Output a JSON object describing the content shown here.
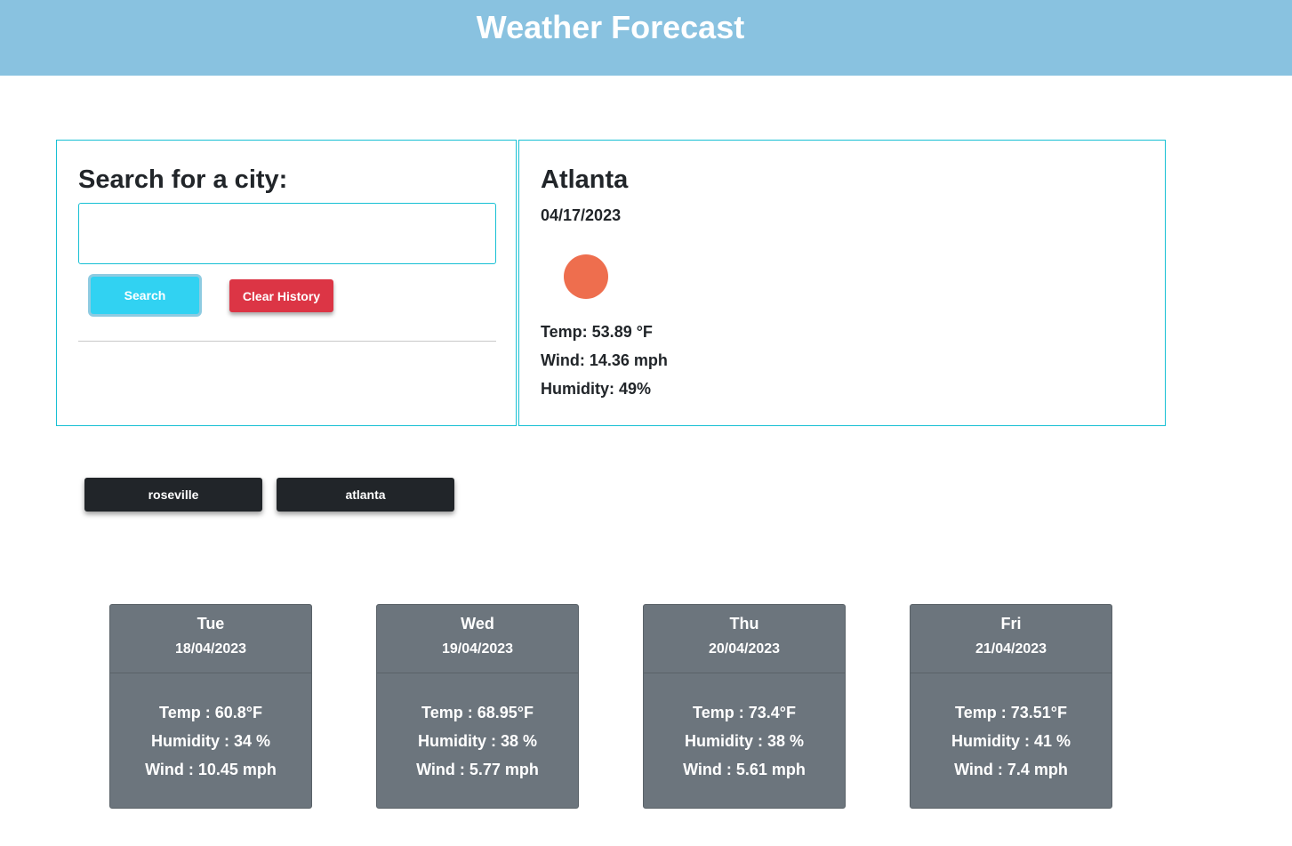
{
  "header": {
    "title": "Weather Forecast"
  },
  "search": {
    "heading": "Search for a city:",
    "input_value": "",
    "search_label": "Search",
    "clear_label": "Clear History"
  },
  "current": {
    "city": "Atlanta",
    "date": "04/17/2023",
    "icon": "weather-icon",
    "icon_color": "#ee6e4e",
    "temp_text": "Temp: 53.89 °F",
    "wind_text": "Wind: 14.36 mph",
    "humidity_text": "Humidity: 49%"
  },
  "history": [
    "roseville",
    "atlanta"
  ],
  "forecast": [
    {
      "day": "Tue",
      "date": "18/04/2023",
      "temp": "Temp : 60.8°F",
      "humidity": "Humidity : 34 %",
      "wind": "Wind : 10.45 mph"
    },
    {
      "day": "Wed",
      "date": "19/04/2023",
      "temp": "Temp : 68.95°F",
      "humidity": "Humidity : 38 %",
      "wind": "Wind : 5.77 mph"
    },
    {
      "day": "Thu",
      "date": "20/04/2023",
      "temp": "Temp : 73.4°F",
      "humidity": "Humidity : 38 %",
      "wind": "Wind : 5.61 mph"
    },
    {
      "day": "Fri",
      "date": "21/04/2023",
      "temp": "Temp : 73.51°F",
      "humidity": "Humidity : 41 %",
      "wind": "Wind : 7.4 mph"
    }
  ],
  "colors": {
    "header_bg": "#89c2e0",
    "panel_border": "#17c0d4",
    "search_button": "#31d2f2",
    "clear_button": "#dc3545",
    "history_button": "#212529",
    "card_bg": "#6c757d"
  }
}
